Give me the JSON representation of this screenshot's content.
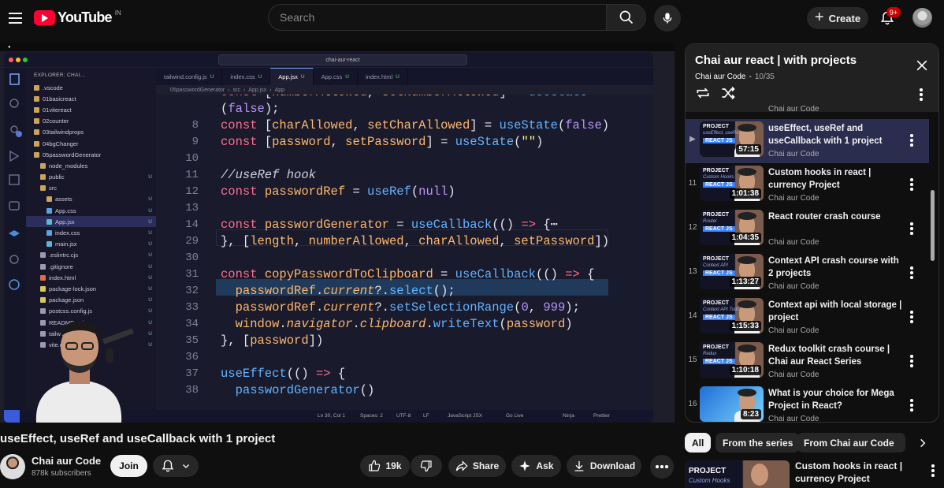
{
  "header": {
    "logo_text": "YouTube",
    "country_code": "IN",
    "search_placeholder": "Search",
    "create_label": "Create",
    "notifications_badge": "9+"
  },
  "vscode": {
    "window_title": "chai-aur-react",
    "explorer_title": "EXPLORER: CHAI...",
    "file_tree": [
      {
        "name": ".vscode",
        "indent": 1,
        "type": "folder",
        "status": ""
      },
      {
        "name": "01basicreact",
        "indent": 1,
        "type": "folder",
        "status": ""
      },
      {
        "name": "01vitereact",
        "indent": 1,
        "type": "folder",
        "status": ""
      },
      {
        "name": "02counter",
        "indent": 1,
        "type": "folder",
        "status": ""
      },
      {
        "name": "03tailwindprops",
        "indent": 1,
        "type": "folder",
        "status": ""
      },
      {
        "name": "04bgChanger",
        "indent": 1,
        "type": "folder",
        "status": ""
      },
      {
        "name": "05passwordGenerator",
        "indent": 1,
        "type": "folder-open",
        "status": ""
      },
      {
        "name": "node_modules",
        "indent": 2,
        "type": "folder",
        "status": ""
      },
      {
        "name": "public",
        "indent": 2,
        "type": "folder",
        "status": "U"
      },
      {
        "name": "src",
        "indent": 2,
        "type": "folder-open",
        "status": ""
      },
      {
        "name": "assets",
        "indent": 3,
        "type": "folder",
        "status": "U"
      },
      {
        "name": "App.css",
        "indent": 3,
        "type": "css",
        "status": "U"
      },
      {
        "name": "App.jsx",
        "indent": 3,
        "type": "jsx",
        "status": "U",
        "active": true
      },
      {
        "name": "index.css",
        "indent": 3,
        "type": "css",
        "status": "U"
      },
      {
        "name": "main.jsx",
        "indent": 3,
        "type": "jsx",
        "status": "U"
      },
      {
        "name": ".eslintrc.cjs",
        "indent": 2,
        "type": "file",
        "status": "U"
      },
      {
        "name": ".gitignore",
        "indent": 2,
        "type": "file",
        "status": "U"
      },
      {
        "name": "index.html",
        "indent": 2,
        "type": "html",
        "status": "U"
      },
      {
        "name": "package-lock.json",
        "indent": 2,
        "type": "json",
        "status": "U"
      },
      {
        "name": "package.json",
        "indent": 2,
        "type": "json",
        "status": "U"
      },
      {
        "name": "postcss.config.js",
        "indent": 2,
        "type": "file",
        "status": "U"
      },
      {
        "name": "README.md",
        "indent": 2,
        "type": "file",
        "status": "U"
      },
      {
        "name": "tailwind.config.js",
        "indent": 2,
        "type": "file",
        "status": "U"
      },
      {
        "name": "vite.config.js",
        "indent": 2,
        "type": "file",
        "status": "U"
      }
    ],
    "tabs": [
      {
        "label": "tailwind.config.js",
        "status": "U",
        "active": false
      },
      {
        "label": "index.css",
        "status": "U",
        "active": false
      },
      {
        "label": "App.jsx",
        "status": "U",
        "active": true
      },
      {
        "label": "App.css",
        "status": "U",
        "active": false
      },
      {
        "label": "index.html",
        "status": "U",
        "active": false
      }
    ],
    "breadcrumb": [
      "05passwordGenerator",
      "src",
      "App.jsx",
      "App"
    ],
    "code_lines": [
      {
        "n": "7",
        "tokens": [
          [
            "kw",
            "const "
          ],
          [
            "pl",
            "["
          ],
          [
            "id",
            "numberAllowed"
          ],
          [
            "pl",
            ", "
          ],
          [
            "id",
            "setNumberAllowed"
          ],
          [
            "pl",
            "] = "
          ],
          [
            "fn",
            "useState"
          ]
        ]
      },
      {
        "n": "",
        "tokens": [
          [
            "pl",
            "("
          ],
          [
            "num",
            "false"
          ],
          [
            "pl",
            ");"
          ]
        ]
      },
      {
        "n": "8",
        "tokens": [
          [
            "kw",
            "const "
          ],
          [
            "pl",
            "["
          ],
          [
            "id",
            "charAllowed"
          ],
          [
            "pl",
            ", "
          ],
          [
            "id",
            "setCharAllowed"
          ],
          [
            "pl",
            "] = "
          ],
          [
            "fn",
            "useState"
          ],
          [
            "pl",
            "("
          ],
          [
            "num",
            "false"
          ],
          [
            "pl",
            ")"
          ]
        ]
      },
      {
        "n": "9",
        "tokens": [
          [
            "kw",
            "const "
          ],
          [
            "pl",
            "["
          ],
          [
            "id",
            "password"
          ],
          [
            "pl",
            ", "
          ],
          [
            "id",
            "setPassword"
          ],
          [
            "pl",
            "] = "
          ],
          [
            "fn",
            "useState"
          ],
          [
            "pl",
            "("
          ],
          [
            "str",
            "\"\""
          ],
          [
            "pl",
            ")"
          ]
        ]
      },
      {
        "n": "10",
        "tokens": []
      },
      {
        "n": "11",
        "tokens": [
          [
            "cm",
            "//useRef hook"
          ]
        ]
      },
      {
        "n": "12",
        "tokens": [
          [
            "kw",
            "const "
          ],
          [
            "id",
            "passwordRef"
          ],
          [
            "pl",
            " = "
          ],
          [
            "fn",
            "useRef"
          ],
          [
            "pl",
            "("
          ],
          [
            "num",
            "null"
          ],
          [
            "pl",
            ")"
          ]
        ]
      },
      {
        "n": "13",
        "tokens": []
      },
      {
        "n": "14",
        "tokens": [
          [
            "kw",
            "const "
          ],
          [
            "id",
            "passwordGenerator"
          ],
          [
            "pl",
            " = "
          ],
          [
            "fn",
            "useCallback"
          ],
          [
            "pl",
            "(() "
          ],
          [
            "kw",
            "=>"
          ],
          [
            "pl",
            " {"
          ],
          [
            "pl",
            "⋯"
          ]
        ]
      },
      {
        "n": "29",
        "tokens": [
          [
            "pl",
            "}, ["
          ],
          [
            "id",
            "length"
          ],
          [
            "pl",
            ", "
          ],
          [
            "id",
            "numberAllowed"
          ],
          [
            "pl",
            ", "
          ],
          [
            "id",
            "charAllowed"
          ],
          [
            "pl",
            ", "
          ],
          [
            "id",
            "setPassword"
          ],
          [
            "pl",
            "])"
          ]
        ]
      },
      {
        "n": "30",
        "tokens": []
      },
      {
        "n": "31",
        "tokens": [
          [
            "kw",
            "const "
          ],
          [
            "id",
            "copyPasswordToClipboard"
          ],
          [
            "pl",
            " = "
          ],
          [
            "fn",
            "useCallback"
          ],
          [
            "pl",
            "(() "
          ],
          [
            "kw",
            "=>"
          ],
          [
            "pl",
            " {"
          ]
        ]
      },
      {
        "n": "32",
        "tokens": [
          [
            "pl",
            "  "
          ],
          [
            "id",
            "passwordRef"
          ],
          [
            "pl",
            "."
          ],
          [
            "it",
            "current"
          ],
          [
            "pl",
            "?."
          ],
          [
            "fn",
            "select"
          ],
          [
            "pl",
            "();"
          ]
        ]
      },
      {
        "n": "33",
        "tokens": [
          [
            "pl",
            "  "
          ],
          [
            "id",
            "passwordRef"
          ],
          [
            "pl",
            "."
          ],
          [
            "it",
            "current"
          ],
          [
            "pl",
            "?."
          ],
          [
            "fn",
            "setSelectionRange"
          ],
          [
            "pl",
            "("
          ],
          [
            "num",
            "0"
          ],
          [
            "pl",
            ", "
          ],
          [
            "num",
            "999"
          ],
          [
            "pl",
            ");"
          ]
        ]
      },
      {
        "n": "34",
        "tokens": [
          [
            "pl",
            "  "
          ],
          [
            "id",
            "window"
          ],
          [
            "pl",
            "."
          ],
          [
            "it",
            "navigator"
          ],
          [
            "pl",
            "."
          ],
          [
            "it",
            "clipboard"
          ],
          [
            "pl",
            "."
          ],
          [
            "fn",
            "writeText"
          ],
          [
            "pl",
            "("
          ],
          [
            "id",
            "password"
          ],
          [
            "pl",
            ")"
          ]
        ]
      },
      {
        "n": "35",
        "tokens": [
          [
            "pl",
            "}, ["
          ],
          [
            "id",
            "password"
          ],
          [
            "pl",
            "])"
          ]
        ]
      },
      {
        "n": "36",
        "tokens": []
      },
      {
        "n": "37",
        "tokens": [
          [
            "fn",
            "useEffect"
          ],
          [
            "pl",
            "(() "
          ],
          [
            "kw",
            "=>"
          ],
          [
            "pl",
            " {"
          ]
        ]
      },
      {
        "n": "38",
        "tokens": [
          [
            "pl",
            "  "
          ],
          [
            "fn",
            "passwordGenerator"
          ],
          [
            "pl",
            "()"
          ]
        ]
      }
    ],
    "status": {
      "position": "Ln 30, Col 1",
      "spaces": "Spaces: 2",
      "encoding": "UTF-8",
      "eol": "LF",
      "language": "JavaScript JSX",
      "golive": "Go Live",
      "ninja": "Ninja",
      "prettier": "Prettier"
    }
  },
  "video": {
    "title": "useEffect, useRef and useCallback with 1 project",
    "channel": "Chai aur Code",
    "subscribers": "878k subscribers",
    "join_label": "Join",
    "likes": "19k",
    "share_label": "Share",
    "ask_label": "Ask",
    "download_label": "Download"
  },
  "playlist": {
    "title": "Chai aur react | with projects",
    "channel": "Chai aur Code",
    "position": "10/35",
    "prev_channel": "Chai aur Code",
    "items": [
      {
        "index": "▶",
        "title": "useEffect, useRef and useCallback with 1 project",
        "channel": "Chai aur Code",
        "duration": "57:15",
        "current": true,
        "thumb_sub": "useEffect, useRef",
        "badge": "REACT JS"
      },
      {
        "index": "11",
        "title": "Custom hooks in react | currency Project",
        "channel": "Chai aur Code",
        "duration": "1:01:38",
        "current": false,
        "thumb_sub": "Custom Hooks",
        "badge": "REACT JS"
      },
      {
        "index": "12",
        "title": "React router crash course",
        "channel": "Chai aur Code",
        "duration": "1:04:35",
        "current": false,
        "thumb_sub": "Router",
        "badge": "REACT JS"
      },
      {
        "index": "13",
        "title": "Context API crash course with 2 projects",
        "channel": "Chai aur Code",
        "duration": "1:13:27",
        "current": false,
        "thumb_sub": "Context API",
        "badge": "REACT JS"
      },
      {
        "index": "14",
        "title": "Context api with local storage | project",
        "channel": "Chai aur Code",
        "duration": "1:15:33",
        "current": false,
        "thumb_sub": "Context API Todo",
        "badge": "REACT JS"
      },
      {
        "index": "15",
        "title": "Redux toolkit crash course | Chai aur React Series",
        "channel": "Chai aur Code",
        "duration": "1:10:18",
        "current": false,
        "thumb_sub": "Redux",
        "badge": "REACT JS"
      },
      {
        "index": "16",
        "title": "What is your choice for Mega Project in React?",
        "channel": "Chai aur Code",
        "duration": "8:23",
        "current": false,
        "thumb_sub": "",
        "badge": ""
      }
    ]
  },
  "chips": [
    "All",
    "From the series",
    "From Chai aur Code"
  ],
  "recommendation": {
    "title": "Custom hooks in react | currency Project",
    "thumb_title": "PROJECT",
    "thumb_sub": "Custom Hooks"
  },
  "colors": {
    "accent": "#ff0033",
    "current_item_bg": "#2a2d4e",
    "badge": "#cc0000"
  }
}
